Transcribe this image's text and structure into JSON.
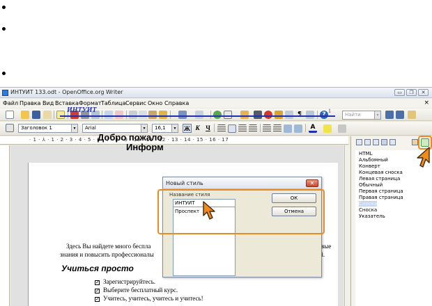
{
  "window": {
    "title": "ИНТУИТ 133.odt - OpenOffice.org Writer",
    "controls": {
      "minimize": "▭",
      "restore": "❐",
      "close": "✕"
    }
  },
  "menu": [
    "Файл",
    "Правка",
    "Вид",
    "Вставка",
    "Формат",
    "Таблица",
    "Сервис",
    "Окно",
    "Справка"
  ],
  "menu_close": "×",
  "toolbar_standard": {
    "find_placeholder": "Найти"
  },
  "toolbar_format": {
    "paragraph_style": "Заголовок 1",
    "font_name": "Arial",
    "font_size": "16,1",
    "bold": "Ж",
    "italic": "К",
    "underline": "Ч"
  },
  "ruler_marks": "· 1 · ⅄ · 1 · 2 · 3 · 4 · 5 · 6 · 7 · 8 · 9 · 10 · 11 · 12 · 13 · 14 · 15 · 16 · 17",
  "document": {
    "header_text": "ИНТУИТ",
    "header_page_number": "1",
    "title_line1": "Добро пожало",
    "title_line2": "Информ",
    "para1_left": "Здесь Вы найдете много беспла",
    "para1_right": "вые",
    "para2_left": "знания и повысить профессионалы",
    "para2_right": "й.",
    "heading2": "Учиться просто",
    "list": [
      "Зарегистрируйтесь.",
      "Выберите бесплатный курс.",
      "Учитесь, учитесь, учитесь и учитесь!"
    ]
  },
  "stylist": {
    "items": [
      "HTML",
      "Альбомный",
      "Конверт",
      "Концевая сноска",
      "Левая страница",
      "Обычный",
      "Первая страница",
      "Правая страница",
      "Сноска",
      "Сноска",
      "Указатель"
    ],
    "selected_index": 8
  },
  "dialog": {
    "title": "Новый стиль",
    "close": "✕",
    "group_label": "Название стиля",
    "input_value": "ИНТУИТ",
    "list_items": [
      "Проспект"
    ],
    "ok_label": "ОК",
    "cancel_label": "Отмена"
  },
  "colors": {
    "highlight": "#e98a22",
    "doc_header_blue": "#1f2fae"
  }
}
